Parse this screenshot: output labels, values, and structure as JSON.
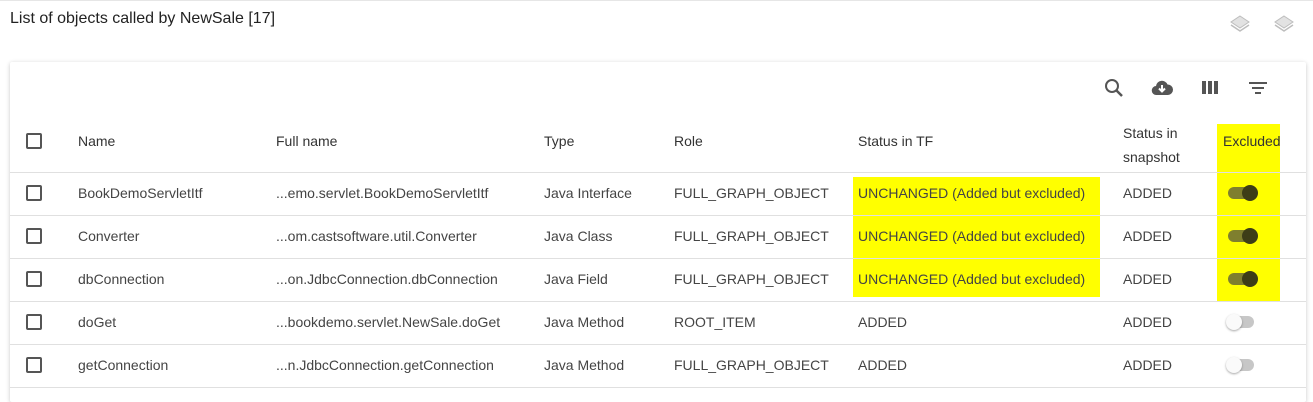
{
  "page": {
    "title": "List of objects called by NewSale [17]"
  },
  "colors": {
    "highlight": "#ffff00",
    "toggle_on_track": "#7f7f2e",
    "toggle_on_knob": "#3d3d17"
  },
  "icons": {
    "top": [
      "layers-icon",
      "layers-icon"
    ],
    "toolbar": [
      "search-icon",
      "cloud-download-icon",
      "columns-icon",
      "filter-icon"
    ]
  },
  "table": {
    "headers": {
      "name": "Name",
      "full_name": "Full name",
      "type": "Type",
      "role": "Role",
      "status_tf": "Status in TF",
      "status_snapshot_1": "Status in",
      "status_snapshot_2": "snapshot",
      "excluded": "Excluded"
    },
    "rows": [
      {
        "name": "BookDemoServletItf",
        "full_name": "...emo.servlet.BookDemoServletItf",
        "type": "Java Interface",
        "role": "FULL_GRAPH_OBJECT",
        "status_tf": "UNCHANGED (Added but excluded)",
        "status_snapshot": "ADDED",
        "excluded": true,
        "highlighted": true
      },
      {
        "name": "Converter",
        "full_name": "...om.castsoftware.util.Converter",
        "type": "Java Class",
        "role": "FULL_GRAPH_OBJECT",
        "status_tf": "UNCHANGED (Added but excluded)",
        "status_snapshot": "ADDED",
        "excluded": true,
        "highlighted": true
      },
      {
        "name": "dbConnection",
        "full_name": "...on.JdbcConnection.dbConnection",
        "type": "Java Field",
        "role": "FULL_GRAPH_OBJECT",
        "status_tf": "UNCHANGED (Added but excluded)",
        "status_snapshot": "ADDED",
        "excluded": true,
        "highlighted": true
      },
      {
        "name": "doGet",
        "full_name": "...bookdemo.servlet.NewSale.doGet",
        "type": "Java Method",
        "role": "ROOT_ITEM",
        "status_tf": "ADDED",
        "status_snapshot": "ADDED",
        "excluded": false,
        "highlighted": false
      },
      {
        "name": "getConnection",
        "full_name": "...n.JdbcConnection.getConnection",
        "type": "Java Method",
        "role": "FULL_GRAPH_OBJECT",
        "status_tf": "ADDED",
        "status_snapshot": "ADDED",
        "excluded": false,
        "highlighted": false
      }
    ]
  }
}
